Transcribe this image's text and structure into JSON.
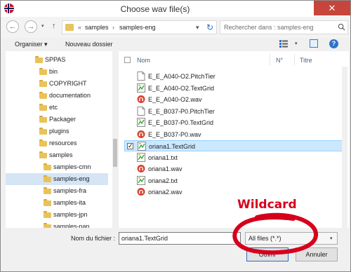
{
  "window": {
    "title": "Choose wav file(s)",
    "close_glyph": "✕"
  },
  "nav": {
    "back_glyph": "←",
    "forward_glyph": "→",
    "up_glyph": "↑",
    "breadcrumb": [
      "samples",
      "samples-eng"
    ],
    "breadcrumb_sep": "«",
    "search_placeholder": "Rechercher dans : samples-eng"
  },
  "toolbar": {
    "organize_label": "Organiser ▾",
    "new_folder_label": "Nouveau dossier"
  },
  "tree": {
    "items": [
      {
        "label": "SPPAS",
        "indent": 0
      },
      {
        "label": "bin",
        "indent": 1
      },
      {
        "label": "COPYRIGHT",
        "indent": 1
      },
      {
        "label": "documentation",
        "indent": 1
      },
      {
        "label": "etc",
        "indent": 1
      },
      {
        "label": "Packager",
        "indent": 1
      },
      {
        "label": "plugins",
        "indent": 1
      },
      {
        "label": "resources",
        "indent": 1
      },
      {
        "label": "samples",
        "indent": 1
      },
      {
        "label": "samples-cmn",
        "indent": 2
      },
      {
        "label": "samples-eng",
        "indent": 2,
        "selected": true
      },
      {
        "label": "samples-fra",
        "indent": 2
      },
      {
        "label": "samples-ita",
        "indent": 2
      },
      {
        "label": "samples-jpn",
        "indent": 2
      },
      {
        "label": "samples-nan",
        "indent": 2
      }
    ]
  },
  "list": {
    "columns": [
      "Nom",
      "N°",
      "Titre"
    ],
    "files": [
      {
        "name": "E_E_A040-O2.PitchTier",
        "type": "doc"
      },
      {
        "name": "E_E_A040-O2.TextGrid",
        "type": "grid"
      },
      {
        "name": "E_E_A040-O2.wav",
        "type": "wav"
      },
      {
        "name": "E_E_B037-P0.PitchTier",
        "type": "doc"
      },
      {
        "name": "E_E_B037-P0.TextGrid",
        "type": "grid"
      },
      {
        "name": "E_E_B037-P0.wav",
        "type": "wav"
      },
      {
        "name": "oriana1.TextGrid",
        "type": "grid",
        "selected": true
      },
      {
        "name": "oriana1.txt",
        "type": "grid"
      },
      {
        "name": "oriana1.wav",
        "type": "wav"
      },
      {
        "name": "oriana2.txt",
        "type": "grid"
      },
      {
        "name": "oriana2.wav",
        "type": "wav"
      }
    ]
  },
  "bottom": {
    "filename_label": "Nom du fichier :",
    "filename_value": "oriana1.TextGrid",
    "filter_value": "All files (*.*)",
    "open_label": "Ouvrir",
    "cancel_label": "Annuler"
  },
  "annotation": {
    "text": "Wildcard",
    "color": "#d6001c"
  },
  "colors": {
    "accent": "#2d6cc0",
    "folder": "#e9c35a",
    "selection": "#cce8ff",
    "close": "#c7453a"
  }
}
